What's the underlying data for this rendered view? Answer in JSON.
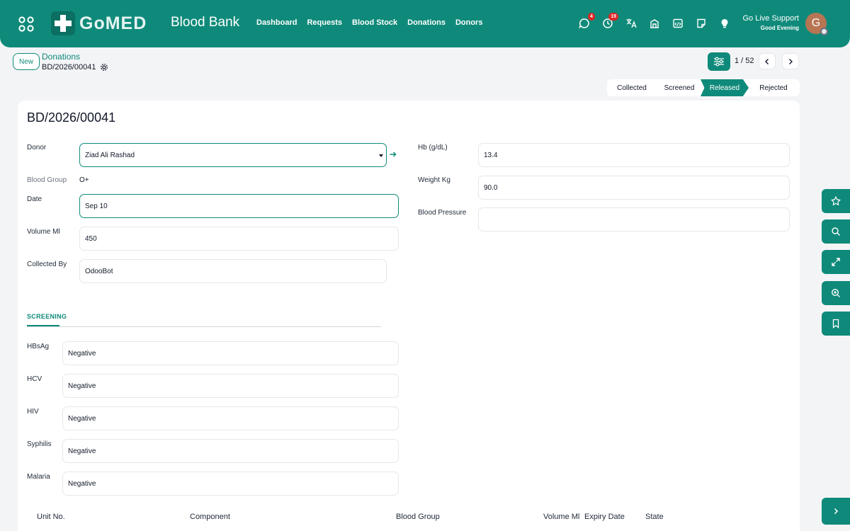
{
  "header": {
    "logo_text": "GoMED",
    "app_title": "Blood Bank",
    "nav": [
      "Dashboard",
      "Requests",
      "Blood Stock",
      "Donations",
      "Donors"
    ],
    "messages_count": "4",
    "activities_count": "19",
    "support_title": "Go Live Support",
    "greeting": "Good Evening",
    "avatar_letter": "G"
  },
  "control": {
    "new_label": "New",
    "breadcrumb_parent": "Donations",
    "breadcrumb_current": "BD/2026/00041",
    "pager": "1 / 52"
  },
  "status": {
    "stages": [
      "Collected",
      "Screened",
      "Released",
      "Rejected"
    ],
    "active": "Released"
  },
  "form": {
    "title": "BD/2026/00041",
    "donor": {
      "label": "Donor",
      "value": "Ziad Ali Rashad"
    },
    "blood_group": {
      "label": "Blood Group",
      "value": "O+"
    },
    "date": {
      "label": "Date",
      "value": "Sep 10"
    },
    "volume": {
      "label": "Volume Ml",
      "value": "450"
    },
    "collected_by": {
      "label": "Collected By",
      "value": "OdooBot"
    },
    "hb": {
      "label": "Hb (g/dL)",
      "value": "13.4"
    },
    "weight": {
      "label": "Weight Kg",
      "value": "90.0"
    },
    "blood_pressure": {
      "label": "Blood Pressure",
      "value": ""
    }
  },
  "screening": {
    "tab_label": "SCREENING",
    "tests": [
      {
        "label": "HBsAg",
        "value": "Negative"
      },
      {
        "label": "HCV",
        "value": "Negative"
      },
      {
        "label": "HIV",
        "value": "Negative"
      },
      {
        "label": "Syphilis",
        "value": "Negative"
      },
      {
        "label": "Malaria",
        "value": "Negative"
      }
    ]
  },
  "units_table": {
    "columns": [
      "Unit No.",
      "Component",
      "Blood Group",
      "Volume Ml",
      "Expiry Date",
      "State"
    ]
  },
  "colors": {
    "primary": "#0f8a7a",
    "badge": "#dc2626",
    "avatar": "#b87553"
  }
}
